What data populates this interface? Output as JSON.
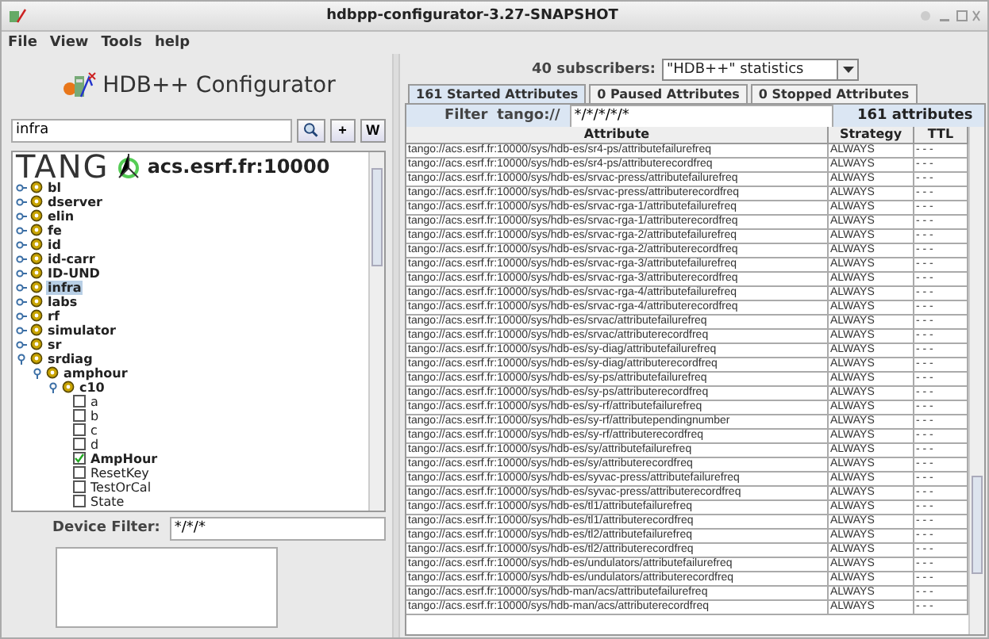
{
  "window": {
    "title": "hdbpp-configurator-3.27-SNAPSHOT"
  },
  "menu": [
    "File",
    "View",
    "Tools",
    "help"
  ],
  "app_title": "HDB++ Configurator",
  "search": {
    "value": "infra",
    "buttons": [
      "+",
      "W"
    ]
  },
  "tree": {
    "logo_text": "TANG",
    "host": "acs.esrf.fr:10000",
    "items": [
      {
        "kind": "domain",
        "label": "bl",
        "expanded": false,
        "selected": false
      },
      {
        "kind": "domain",
        "label": "dserver",
        "expanded": false,
        "selected": false
      },
      {
        "kind": "domain",
        "label": "elin",
        "expanded": false,
        "selected": false
      },
      {
        "kind": "domain",
        "label": "fe",
        "expanded": false,
        "selected": false
      },
      {
        "kind": "domain",
        "label": "id",
        "expanded": false,
        "selected": false
      },
      {
        "kind": "domain",
        "label": "id-carr",
        "expanded": false,
        "selected": false
      },
      {
        "kind": "domain",
        "label": "ID-UND",
        "expanded": false,
        "selected": false
      },
      {
        "kind": "domain",
        "label": "infra",
        "expanded": false,
        "selected": true
      },
      {
        "kind": "domain",
        "label": "labs",
        "expanded": false,
        "selected": false
      },
      {
        "kind": "domain",
        "label": "rf",
        "expanded": false,
        "selected": false
      },
      {
        "kind": "domain",
        "label": "simulator",
        "expanded": false,
        "selected": false
      },
      {
        "kind": "domain",
        "label": "sr",
        "expanded": false,
        "selected": false
      },
      {
        "kind": "domain",
        "label": "srdiag",
        "expanded": true,
        "selected": false,
        "children": [
          {
            "kind": "domain",
            "label": "amphour",
            "expanded": true,
            "selected": false,
            "children": [
              {
                "kind": "domain",
                "label": "c10",
                "expanded": true,
                "selected": false,
                "children": [
                  {
                    "kind": "attribute",
                    "label": "a",
                    "checked": false
                  },
                  {
                    "kind": "attribute",
                    "label": "b",
                    "checked": false
                  },
                  {
                    "kind": "attribute",
                    "label": "c",
                    "checked": false
                  },
                  {
                    "kind": "attribute",
                    "label": "d",
                    "checked": false
                  },
                  {
                    "kind": "attribute",
                    "label": "AmpHour",
                    "checked": true
                  },
                  {
                    "kind": "attribute",
                    "label": "ResetKey",
                    "checked": false
                  },
                  {
                    "kind": "attribute",
                    "label": "TestOrCal",
                    "checked": false
                  },
                  {
                    "kind": "attribute",
                    "label": "State",
                    "checked": false
                  }
                ]
              }
            ]
          }
        ]
      }
    ]
  },
  "device_filter": {
    "label": "Device Filter:",
    "value": "*/*/*"
  },
  "subscribers": {
    "label": "40 subscribers:",
    "value": "\"HDB++\" statistics"
  },
  "tabs": [
    {
      "label": "161 Started Attributes",
      "selected": true
    },
    {
      "label": "0 Paused Attributes",
      "selected": false
    },
    {
      "label": "0 Stopped Attributes",
      "selected": false
    }
  ],
  "filter": {
    "label": "Filter",
    "prefix": "tango://",
    "value": "*/*/*/*/*",
    "count": "161 attributes"
  },
  "table": {
    "columns": [
      "Attribute",
      "Strategy",
      "TTL"
    ],
    "rows": [
      [
        "tango://acs.esrf.fr:10000/sys/hdb-es/sr4-ps/attributefailurefreq",
        "ALWAYS",
        "- - -"
      ],
      [
        "tango://acs.esrf.fr:10000/sys/hdb-es/sr4-ps/attributerecordfreq",
        "ALWAYS",
        "- - -"
      ],
      [
        "tango://acs.esrf.fr:10000/sys/hdb-es/srvac-press/attributefailurefreq",
        "ALWAYS",
        "- - -"
      ],
      [
        "tango://acs.esrf.fr:10000/sys/hdb-es/srvac-press/attributerecordfreq",
        "ALWAYS",
        "- - -"
      ],
      [
        "tango://acs.esrf.fr:10000/sys/hdb-es/srvac-rga-1/attributefailurefreq",
        "ALWAYS",
        "- - -"
      ],
      [
        "tango://acs.esrf.fr:10000/sys/hdb-es/srvac-rga-1/attributerecordfreq",
        "ALWAYS",
        "- - -"
      ],
      [
        "tango://acs.esrf.fr:10000/sys/hdb-es/srvac-rga-2/attributefailurefreq",
        "ALWAYS",
        "- - -"
      ],
      [
        "tango://acs.esrf.fr:10000/sys/hdb-es/srvac-rga-2/attributerecordfreq",
        "ALWAYS",
        "- - -"
      ],
      [
        "tango://acs.esrf.fr:10000/sys/hdb-es/srvac-rga-3/attributefailurefreq",
        "ALWAYS",
        "- - -"
      ],
      [
        "tango://acs.esrf.fr:10000/sys/hdb-es/srvac-rga-3/attributerecordfreq",
        "ALWAYS",
        "- - -"
      ],
      [
        "tango://acs.esrf.fr:10000/sys/hdb-es/srvac-rga-4/attributefailurefreq",
        "ALWAYS",
        "- - -"
      ],
      [
        "tango://acs.esrf.fr:10000/sys/hdb-es/srvac-rga-4/attributerecordfreq",
        "ALWAYS",
        "- - -"
      ],
      [
        "tango://acs.esrf.fr:10000/sys/hdb-es/srvac/attributefailurefreq",
        "ALWAYS",
        "- - -"
      ],
      [
        "tango://acs.esrf.fr:10000/sys/hdb-es/srvac/attributerecordfreq",
        "ALWAYS",
        "- - -"
      ],
      [
        "tango://acs.esrf.fr:10000/sys/hdb-es/sy-diag/attributefailurefreq",
        "ALWAYS",
        "- - -"
      ],
      [
        "tango://acs.esrf.fr:10000/sys/hdb-es/sy-diag/attributerecordfreq",
        "ALWAYS",
        "- - -"
      ],
      [
        "tango://acs.esrf.fr:10000/sys/hdb-es/sy-ps/attributefailurefreq",
        "ALWAYS",
        "- - -"
      ],
      [
        "tango://acs.esrf.fr:10000/sys/hdb-es/sy-ps/attributerecordfreq",
        "ALWAYS",
        "- - -"
      ],
      [
        "tango://acs.esrf.fr:10000/sys/hdb-es/sy-rf/attributefailurefreq",
        "ALWAYS",
        "- - -"
      ],
      [
        "tango://acs.esrf.fr:10000/sys/hdb-es/sy-rf/attributependingnumber",
        "ALWAYS",
        "- - -"
      ],
      [
        "tango://acs.esrf.fr:10000/sys/hdb-es/sy-rf/attributerecordfreq",
        "ALWAYS",
        "- - -"
      ],
      [
        "tango://acs.esrf.fr:10000/sys/hdb-es/sy/attributefailurefreq",
        "ALWAYS",
        "- - -"
      ],
      [
        "tango://acs.esrf.fr:10000/sys/hdb-es/sy/attributerecordfreq",
        "ALWAYS",
        "- - -"
      ],
      [
        "tango://acs.esrf.fr:10000/sys/hdb-es/syvac-press/attributefailurefreq",
        "ALWAYS",
        "- - -"
      ],
      [
        "tango://acs.esrf.fr:10000/sys/hdb-es/syvac-press/attributerecordfreq",
        "ALWAYS",
        "- - -"
      ],
      [
        "tango://acs.esrf.fr:10000/sys/hdb-es/tl1/attributefailurefreq",
        "ALWAYS",
        "- - -"
      ],
      [
        "tango://acs.esrf.fr:10000/sys/hdb-es/tl1/attributerecordfreq",
        "ALWAYS",
        "- - -"
      ],
      [
        "tango://acs.esrf.fr:10000/sys/hdb-es/tl2/attributefailurefreq",
        "ALWAYS",
        "- - -"
      ],
      [
        "tango://acs.esrf.fr:10000/sys/hdb-es/tl2/attributerecordfreq",
        "ALWAYS",
        "- - -"
      ],
      [
        "tango://acs.esrf.fr:10000/sys/hdb-es/undulators/attributefailurefreq",
        "ALWAYS",
        "- - -"
      ],
      [
        "tango://acs.esrf.fr:10000/sys/hdb-es/undulators/attributerecordfreq",
        "ALWAYS",
        "- - -"
      ],
      [
        "tango://acs.esrf.fr:10000/sys/hdb-man/acs/attributefailurefreq",
        "ALWAYS",
        "- - -"
      ],
      [
        "tango://acs.esrf.fr:10000/sys/hdb-man/acs/attributerecordfreq",
        "ALWAYS",
        "- - -"
      ]
    ]
  }
}
